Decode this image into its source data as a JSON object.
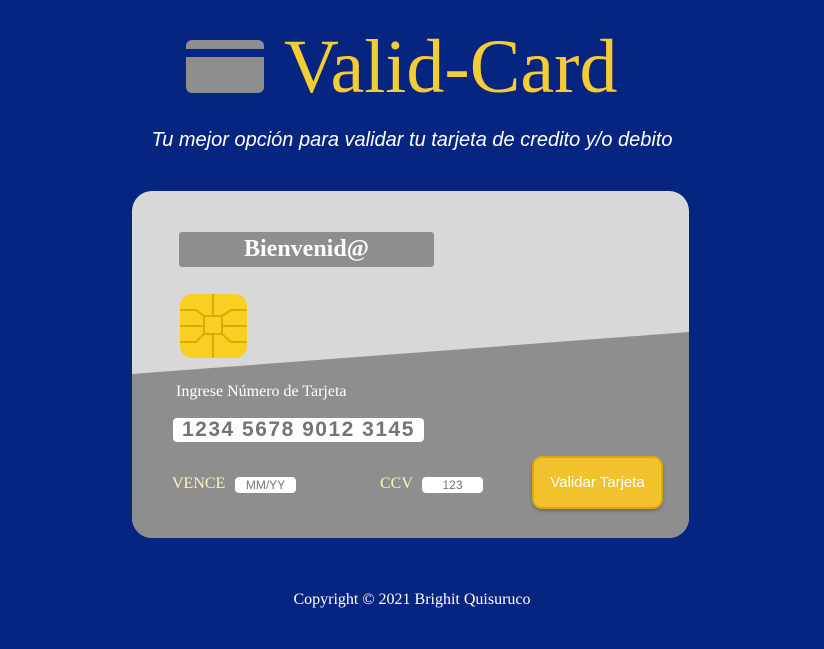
{
  "header": {
    "logo_icon": "credit-card-icon",
    "title": "Valid-Card",
    "tagline": "Tu mejor opción para validar tu tarjeta de credito y/o debito"
  },
  "card": {
    "welcome": "Bienvenid@",
    "chip_icon": "card-chip-icon",
    "number_label": "Ingrese Número de Tarjeta",
    "number_placeholder": "1234 5678 9012 3145",
    "expiry_label": "VENCE",
    "expiry_placeholder": "MM/YY",
    "ccv_label": "CCV",
    "ccv_placeholder": "123",
    "submit_label": "Validar Tarjeta"
  },
  "footer": {
    "copyright": "Copyright © 2021 Brighit Quisuruco"
  },
  "colors": {
    "background": "#052580",
    "accent": "#f4cc33",
    "card_light": "#d8d8d8",
    "card_dark": "#8e8e8e",
    "chip": "#f8cf22"
  }
}
